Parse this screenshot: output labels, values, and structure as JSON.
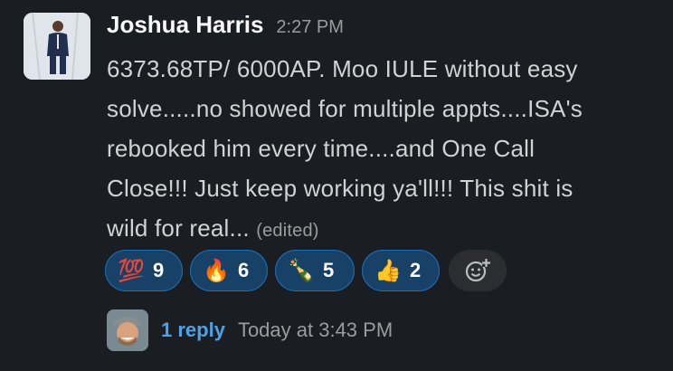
{
  "message": {
    "author": "Joshua Harris",
    "time": "2:27 PM",
    "text_lines": [
      "6373.68TP/ 6000AP. Moo IULE without easy",
      "solve.....no showed for multiple appts....ISA's",
      "rebooked him every time....and One Call",
      "Close!!! Just keep working ya'll!!! This shit is",
      "wild for real..."
    ],
    "edited_label": "(edited)"
  },
  "reactions": [
    {
      "emoji": "💯",
      "icon": "hundred-points-icon",
      "count": "9"
    },
    {
      "emoji": "🔥",
      "icon": "fire-icon",
      "count": "6"
    },
    {
      "emoji": "🍾",
      "icon": "champagne-icon",
      "count": "5"
    },
    {
      "emoji": "👍",
      "icon": "thumbs-up-icon",
      "count": "2"
    }
  ],
  "add_reaction_icon": "add-reaction-icon",
  "thread": {
    "reply_count": "1 reply",
    "last_reply": "Today at 3:43 PM"
  },
  "colors": {
    "background": "#1a1d21",
    "reaction_bg": "#174166",
    "reaction_border": "#1d6fb5",
    "link": "#4ea3e6"
  }
}
